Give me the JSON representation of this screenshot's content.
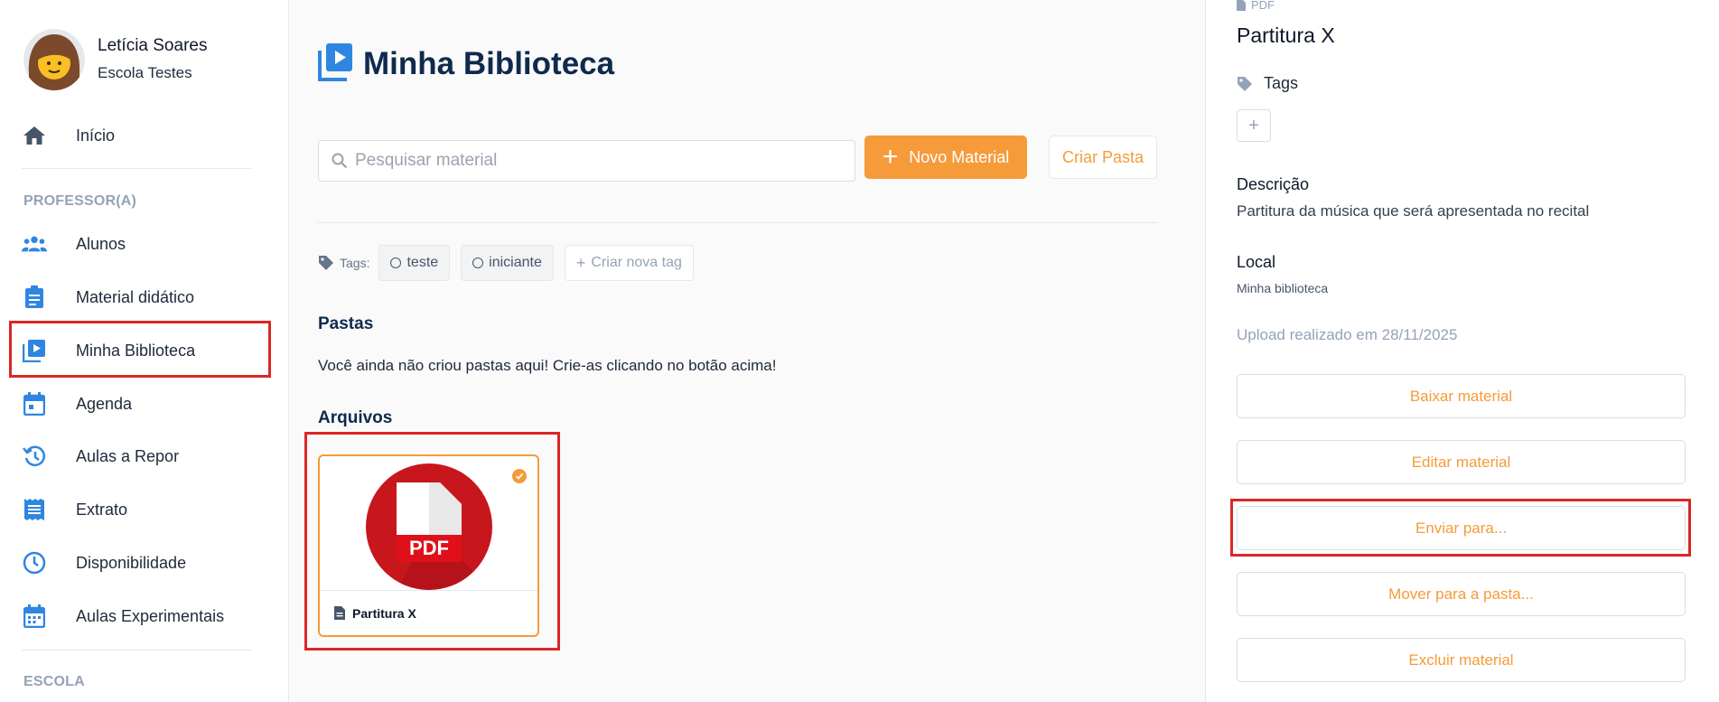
{
  "user": {
    "name": "Letícia Soares",
    "school": "Escola Testes"
  },
  "sidebar": {
    "home_label": "Início",
    "section_professor": "PROFESSOR(A)",
    "items": [
      {
        "label": "Alunos",
        "icon": "users-icon"
      },
      {
        "label": "Material didático",
        "icon": "clipboard-icon"
      },
      {
        "label": "Minha Biblioteca",
        "icon": "library-icon"
      },
      {
        "label": "Agenda",
        "icon": "calendar-icon"
      },
      {
        "label": "Aulas a Repor",
        "icon": "history-icon"
      },
      {
        "label": "Extrato",
        "icon": "receipt-icon"
      },
      {
        "label": "Disponibilidade",
        "icon": "clock-icon"
      },
      {
        "label": "Aulas Experimentais",
        "icon": "calendar-grid-icon"
      }
    ],
    "section_escola": "ESCOLA"
  },
  "main": {
    "title": "Minha Biblioteca",
    "search_placeholder": "Pesquisar material",
    "new_material_label": "Novo Material",
    "create_folder_label": "Criar Pasta",
    "tags_label": "Tags:",
    "tags": [
      "teste",
      "iniciante"
    ],
    "new_tag_label": "Criar nova tag",
    "folders_heading": "Pastas",
    "folders_empty": "Você ainda não criou pastas aqui! Crie-as clicando no botão acima!",
    "files_heading": "Arquivos",
    "files": [
      {
        "name": "Partitura X",
        "type_badge": "PDF"
      }
    ]
  },
  "details": {
    "type": "PDF",
    "title": "Partitura X",
    "tags_label": "Tags",
    "add_tag": "+",
    "description_label": "Descrição",
    "description": "Partitura da música que será apresentada no recital",
    "location_label": "Local",
    "location": "Minha biblioteca",
    "upload_info": "Upload realizado em 28/11/2025",
    "actions": {
      "download": "Baixar material",
      "edit": "Editar material",
      "send": "Enviar para...",
      "move": "Mover para a pasta...",
      "delete": "Excluir material"
    }
  },
  "colors": {
    "accent": "#f59b3a",
    "primary_icon": "#2f86e0",
    "title": "#0f2a4d",
    "highlight": "#dc2626",
    "pdf_red": "#c8161d"
  }
}
